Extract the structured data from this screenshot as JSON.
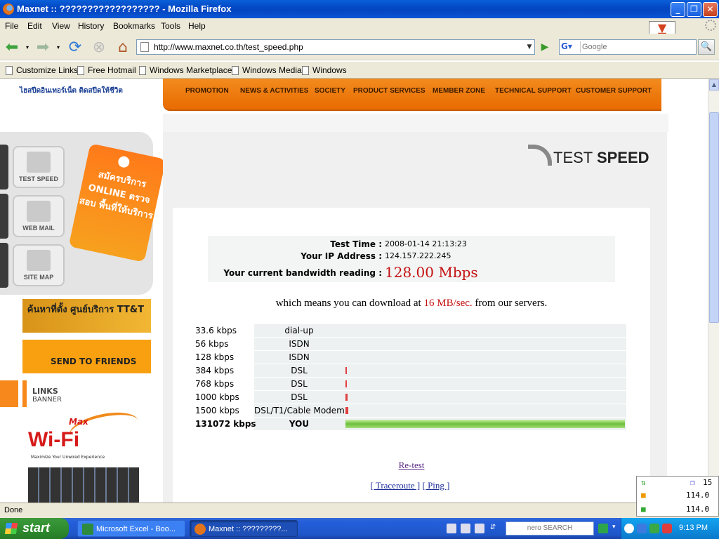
{
  "window": {
    "title": "Maxnet :: ?????????????????? - Mozilla Firefox"
  },
  "menu": [
    "File",
    "Edit",
    "View",
    "History",
    "Bookmarks",
    "Tools",
    "Help"
  ],
  "nav": {
    "url": "http://www.maxnet.co.th/test_speed.php",
    "search_placeholder": "Google"
  },
  "bookmarks": [
    "Customize Links",
    "Free Hotmail",
    "Windows Marketplace",
    "Windows Media",
    "Windows"
  ],
  "site": {
    "nav_items": [
      "PROMOTION",
      "NEWS & ACTIVITIES",
      "SOCIETY",
      "PRODUCT SERVICES",
      "MEMBER ZONE",
      "TECHNICAL SUPPORT",
      "CUSTOMER SUPPORT"
    ],
    "side_buttons": [
      "TEST SPEED",
      "WEB MAIL",
      "SITE MAP"
    ],
    "promo_tag_text": "สมัครบริการ ONLINE ตรวจสอบ พื้นที่ให้บริการ",
    "banner_find": "ค้นหาที่ตั้ง ศูนย์บริการ TT&T",
    "banner_send": "SEND TO FRIENDS",
    "links_banner_title": "LINKS",
    "links_banner_sub": "BANNER",
    "wifi_brand": "Max",
    "wifi_big": "Wi-Fi",
    "wifi_tagline": "Maximize Your Unwired Experience",
    "logo_slogan": "ไฮสปีดอินเทอร์เน็ต ติดสปีดให้ชีวิต"
  },
  "test": {
    "page_title_light": "TEST",
    "page_title_bold": "SPEED",
    "time_label": "Test Time :",
    "time_value": "2008-01-14 21:13:23",
    "ip_label": "Your IP Address :",
    "ip_value": "124.157.222.245",
    "bw_label": "Your current bandwidth reading :",
    "bw_value": "128.00 Mbps",
    "download_prefix": "which means you can download at",
    "download_rate": "16 MB/sec.",
    "download_suffix": "from our servers.",
    "rows": [
      {
        "kbps": "33.6 kbps",
        "type": "dial-up",
        "bar_fraction": 0
      },
      {
        "kbps": "56 kbps",
        "type": "ISDN",
        "bar_fraction": 0
      },
      {
        "kbps": "128 kbps",
        "type": "ISDN",
        "bar_fraction": 0
      },
      {
        "kbps": "384 kbps",
        "type": "DSL",
        "bar_fraction": 0.003
      },
      {
        "kbps": "768 kbps",
        "type": "DSL",
        "bar_fraction": 0.006
      },
      {
        "kbps": "1000 kbps",
        "type": "DSL",
        "bar_fraction": 0.008
      },
      {
        "kbps": "1500 kbps",
        "type": "DSL/T1/Cable Modem",
        "bar_fraction": 0.011
      },
      {
        "kbps": "131072 kbps",
        "type": "YOU",
        "bar_fraction": 1.0
      }
    ],
    "retest": "Re-test",
    "traceroute": "[ Traceroute ]",
    "ping": "[ Ping ]"
  },
  "status": {
    "text": "Done"
  },
  "mini_widget": {
    "count": "15",
    "val1": "114.0",
    "val2": "114.0"
  },
  "taskbar": {
    "start": "start",
    "tasks": [
      "Microsoft Excel - Boo...",
      "Maxnet :: ?????????..."
    ],
    "nero_label": "nero SEARCH",
    "clock": "9:13 PM"
  },
  "colors": {
    "accent_orange": "#f38b1e",
    "speed_red": "#c41010",
    "bar_green": "#6bbf3a"
  }
}
